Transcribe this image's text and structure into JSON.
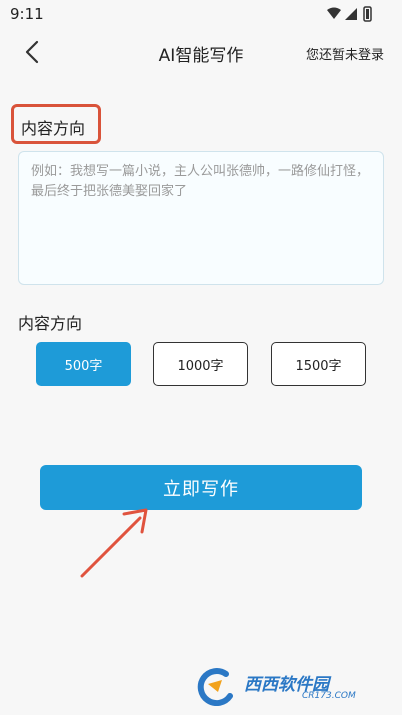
{
  "status_bar": {
    "time": "9:11"
  },
  "nav": {
    "title": "AI智能写作",
    "login_text": "您还暂未登录"
  },
  "content_direction": {
    "title": "内容方向",
    "placeholder": "例如：我想写一篇小说，主人公叫张德帅，一路修仙打怪，最后终于把张德美娶回家了"
  },
  "length": {
    "title": "内容方向",
    "options": [
      "500字",
      "1000字",
      "1500字"
    ],
    "selected": "500字"
  },
  "write_button": {
    "label": "立即写作"
  },
  "watermark": {
    "text": "西西软件园",
    "sub": "CR173.COM"
  },
  "colors": {
    "accent": "#1e9bd8",
    "highlight_border": "#d9533a",
    "arrow": "#e0533e"
  }
}
